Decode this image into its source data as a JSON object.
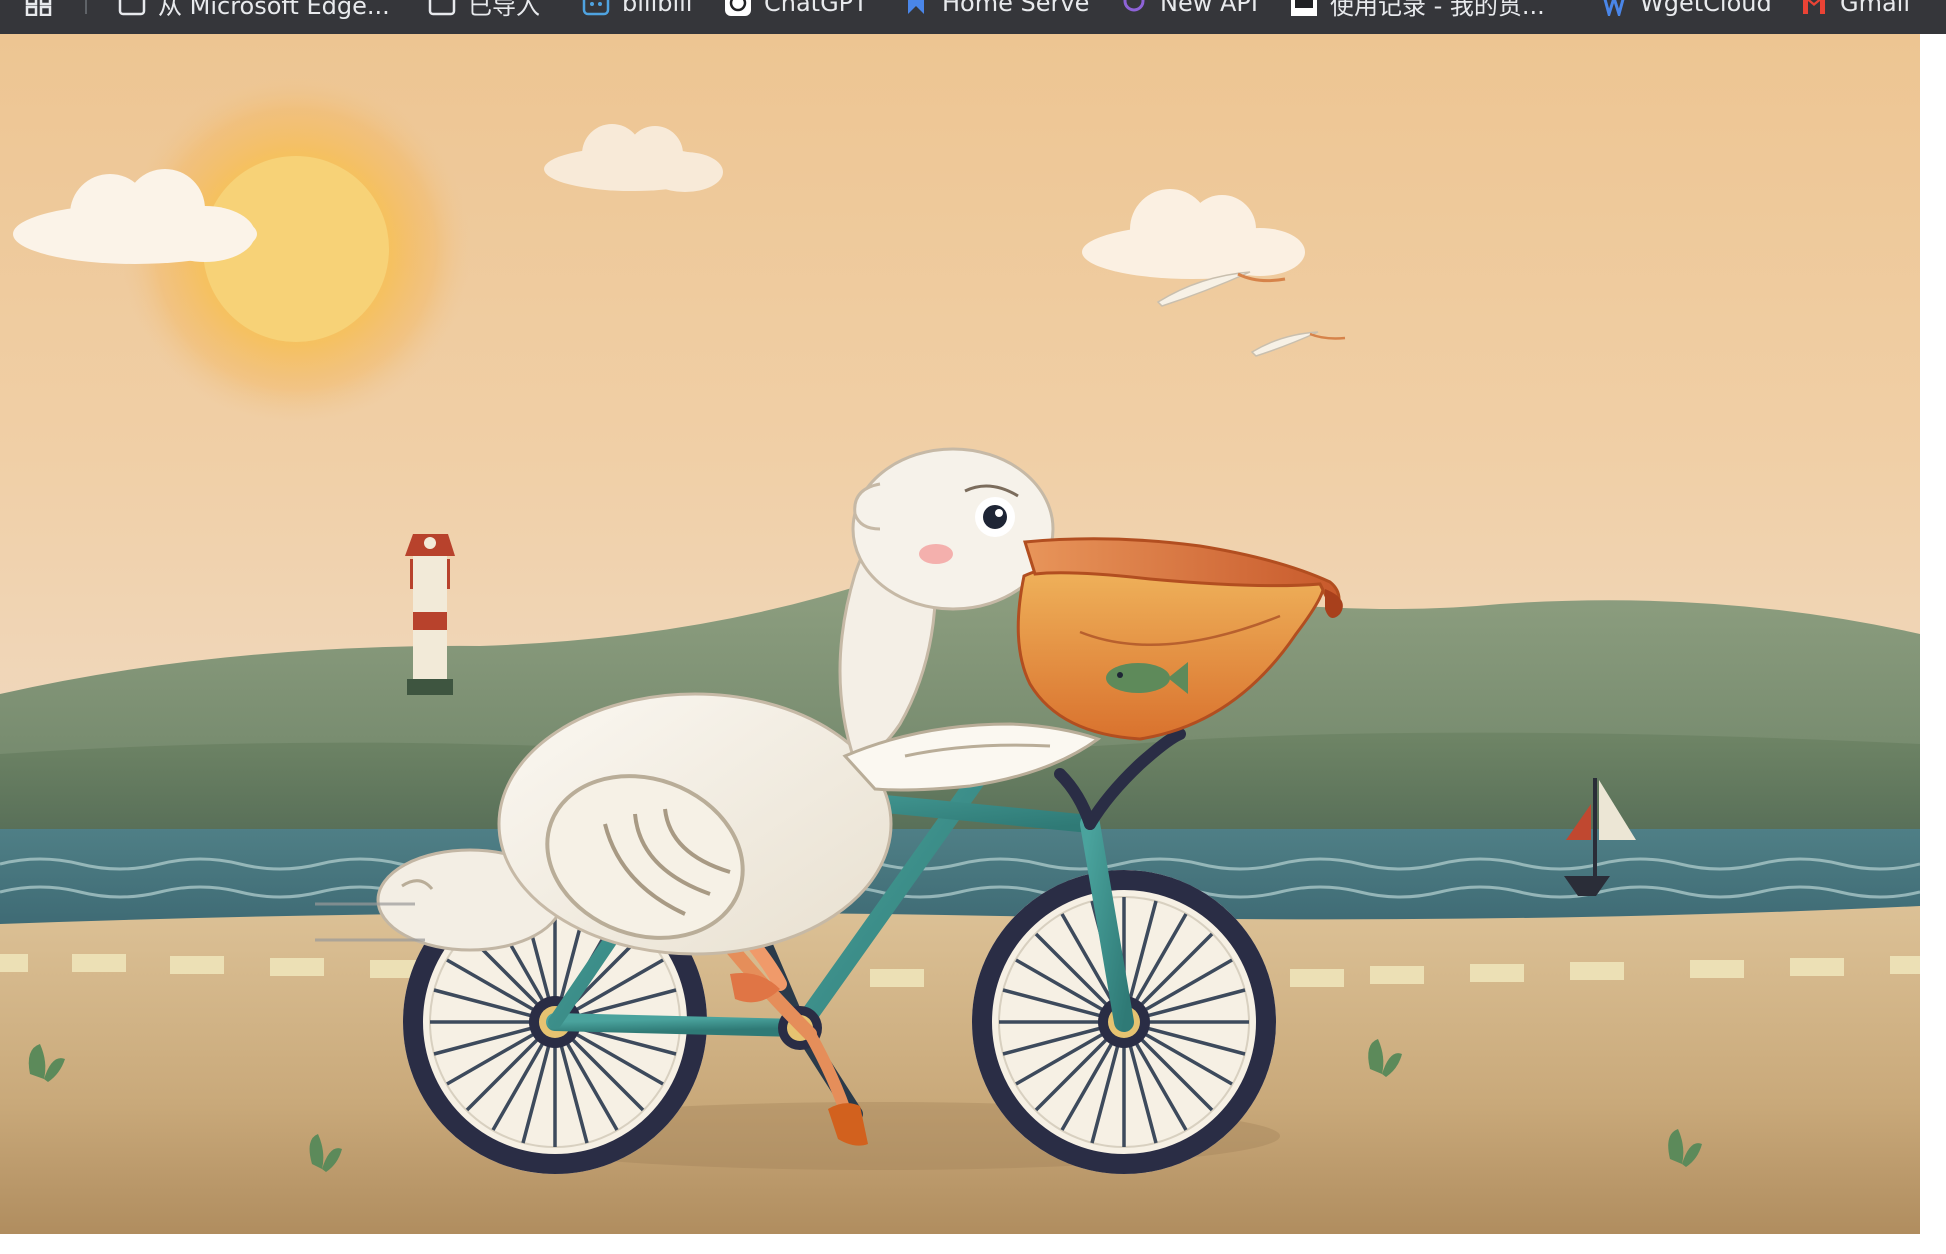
{
  "bookmarks_bar": {
    "apps_icon": "apps-grid-icon",
    "items": [
      {
        "label": "从 Microsoft Edge...",
        "icon": "folder-icon"
      },
      {
        "label": "已导入",
        "icon": "folder-icon"
      },
      {
        "label": "bilibili",
        "icon": "bilibili-icon"
      },
      {
        "label": "ChatGPT",
        "icon": "openai-icon"
      },
      {
        "label": "Home Serve",
        "icon": "bookmark-flag-icon"
      },
      {
        "label": "New API",
        "icon": "new-api-icon"
      },
      {
        "label": "使用记录 - 我的贯...",
        "icon": "site-favicon-icon"
      },
      {
        "label": "WgetCloud",
        "icon": "wgetcloud-icon"
      },
      {
        "label": "Gmail",
        "icon": "gmail-icon"
      }
    ]
  },
  "scene": {
    "colors": {
      "sky_top": "#eec592",
      "sky_bottom": "#efd8c4",
      "sun": "#f7d277",
      "hills": "#8c9d7f",
      "water": "#4a7a82",
      "sand": "#d7bb8c",
      "bike_frame": "#3f8f8b",
      "pelican_body": "#f3efe6",
      "beak": "#e08a40",
      "lighthouse_red": "#b8422c",
      "sail": "#ece6d5"
    }
  }
}
